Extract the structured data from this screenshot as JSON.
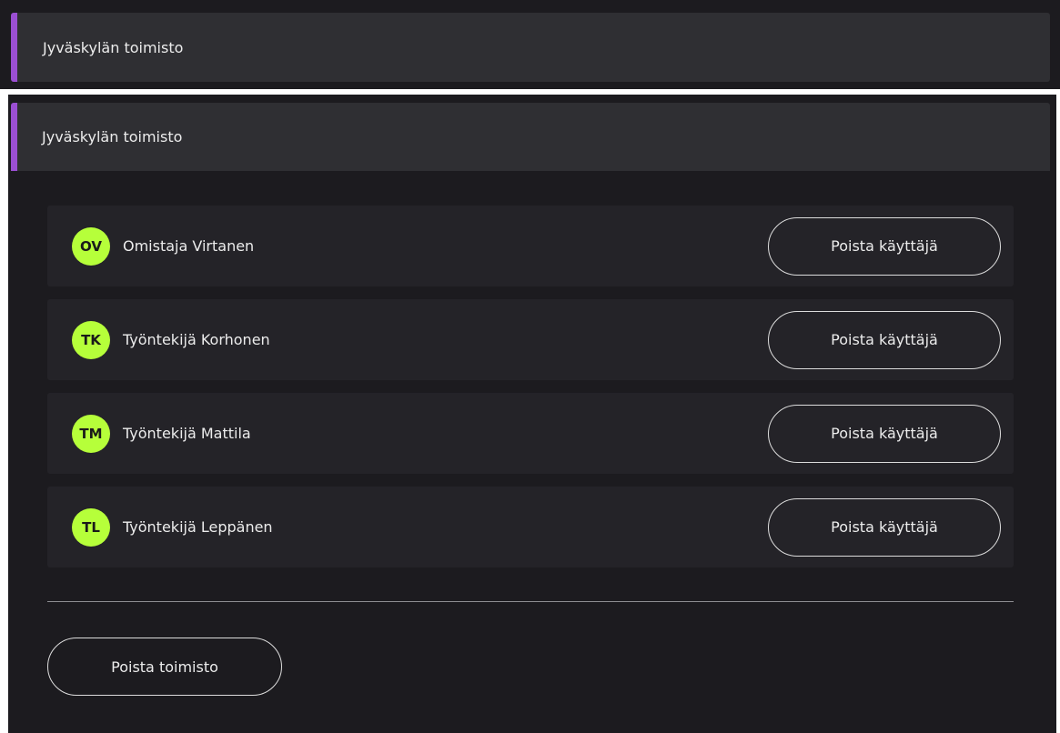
{
  "offices": [
    {
      "title": "Jyväskylän toimisto"
    },
    {
      "title": "Jyväskylän toimisto",
      "users": [
        {
          "initials": "OV",
          "name": "Omistaja Virtanen",
          "action": "Poista käyttäjä"
        },
        {
          "initials": "TK",
          "name": "Työntekijä Korhonen",
          "action": "Poista käyttäjä"
        },
        {
          "initials": "TM",
          "name": "Työntekijä Mattila",
          "action": "Poista käyttäjä"
        },
        {
          "initials": "TL",
          "name": "Työntekijä Leppänen",
          "action": "Poista käyttäjä"
        }
      ],
      "delete_office_label": "Poista toimisto"
    }
  ],
  "colors": {
    "accent": "#9b4fd3",
    "avatar": "#b6ff3a",
    "background": "#1c1b1f",
    "header": "#2f2f33",
    "row": "#242328"
  }
}
